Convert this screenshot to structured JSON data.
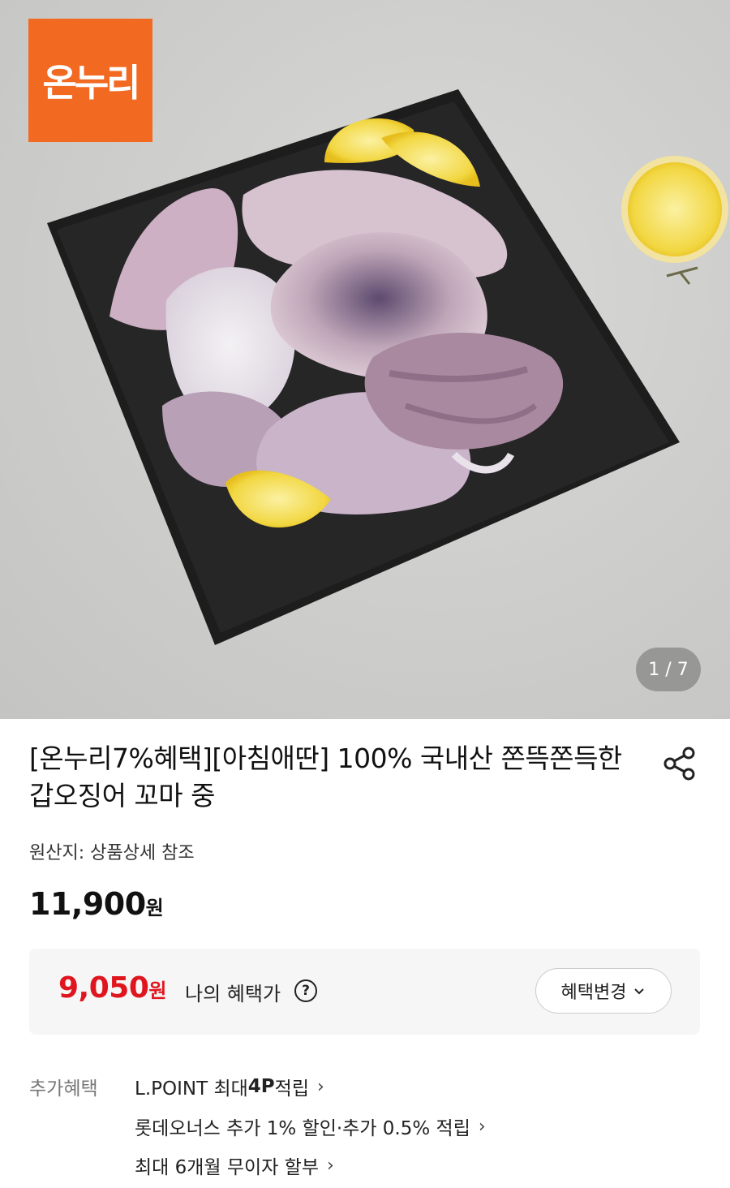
{
  "hero": {
    "logo_text": "온누리",
    "page_counter": "1 / 7"
  },
  "product": {
    "title": "[온누리7%혜택][아침애딴] 100% 국내산 쫀뜩쫀득한 갑오징어 꼬마 중",
    "origin": "원산지: 상품상세 참조",
    "price": "11,900",
    "price_unit": "원"
  },
  "benefit": {
    "price": "9,050",
    "price_unit": "원",
    "label": "나의 혜택가",
    "help_symbol": "?",
    "change_label": "혜택변경",
    "accent_color": "#e0161f"
  },
  "extra": {
    "label": "추가혜택",
    "items": [
      {
        "prefix": "L.POINT 최대 ",
        "bold": "4P",
        "suffix": " 적립"
      },
      {
        "prefix": "롯데오너스 추가 1% 할인·추가 0.5% 적립",
        "bold": "",
        "suffix": ""
      },
      {
        "prefix": "최대 6개월 무이자 할부",
        "bold": "",
        "suffix": ""
      }
    ]
  },
  "icons": {
    "share": "share-icon",
    "chevron_right": "chevron-right-icon",
    "chevron_down": "chevron-down-icon"
  }
}
